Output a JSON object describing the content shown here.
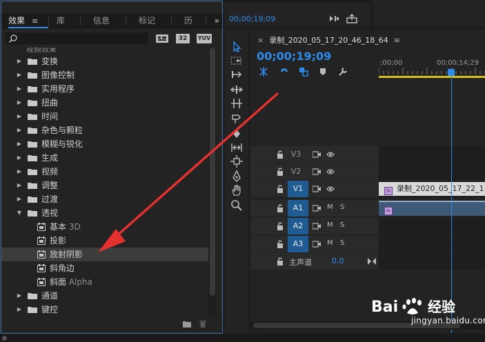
{
  "colors": {
    "accent": "#2d8ceb",
    "arrow": "#e53030",
    "work_area": "#d4c21a"
  },
  "effects_panel": {
    "tabs": [
      "效果",
      "库",
      "信息",
      "标记",
      "历史"
    ],
    "tab_menu": "≡",
    "overflow": "»",
    "search_placeholder": "",
    "filter_icons": [
      "accelerated-effects-icon",
      "32-bit-icon",
      "yuv-icon"
    ],
    "filter_labels": {
      "acc": "▦",
      "b32": "32",
      "yuv": "YUV"
    },
    "tree_top": "视频效果",
    "categories": [
      {
        "label": "变换"
      },
      {
        "label": "图像控制"
      },
      {
        "label": "实用程序"
      },
      {
        "label": "扭曲"
      },
      {
        "label": "时间"
      },
      {
        "label": "杂色与颗粒"
      },
      {
        "label": "模糊与锐化"
      },
      {
        "label": "生成"
      },
      {
        "label": "视频"
      },
      {
        "label": "调整"
      },
      {
        "label": "过渡"
      }
    ],
    "open_category": "透视",
    "children": [
      {
        "label": "基本",
        "suffix": "3D"
      },
      {
        "label": "投影",
        "suffix": ""
      },
      {
        "label": "放射阴影",
        "suffix": ""
      },
      {
        "label": "斜角边",
        "suffix": ""
      },
      {
        "label": "斜面",
        "suffix": "Alpha"
      }
    ],
    "selected_child": "放射阴影",
    "after": [
      {
        "label": "通道"
      },
      {
        "label": "键控"
      }
    ]
  },
  "source": {
    "timecode": "00;00;19;09"
  },
  "timeline": {
    "sequence_name": "录制_2020_05_17_20_46_18_64",
    "close": "×",
    "menu": "≡",
    "timecode": "00;00;19;09",
    "ruler": {
      "start": ";00;00",
      "mark": "00;00;14;29"
    },
    "tracks": [
      {
        "name": "V3",
        "active": false,
        "kind": "video"
      },
      {
        "name": "V2",
        "active": false,
        "kind": "video"
      },
      {
        "name": "V1",
        "active": true,
        "kind": "video",
        "clip": "录制_2020_05_17_22_1"
      },
      {
        "name": "A1",
        "active": true,
        "kind": "audio"
      },
      {
        "name": "A2",
        "active": true,
        "kind": "audio"
      },
      {
        "name": "A3",
        "active": true,
        "kind": "audio"
      }
    ],
    "mute": "M",
    "solo": "S",
    "fx_badge": "fx",
    "master": {
      "label": "主声道",
      "value": "0.0"
    }
  },
  "watermark": {
    "brand": "Bai du 经验",
    "url": "jingyan.baidu.com"
  }
}
